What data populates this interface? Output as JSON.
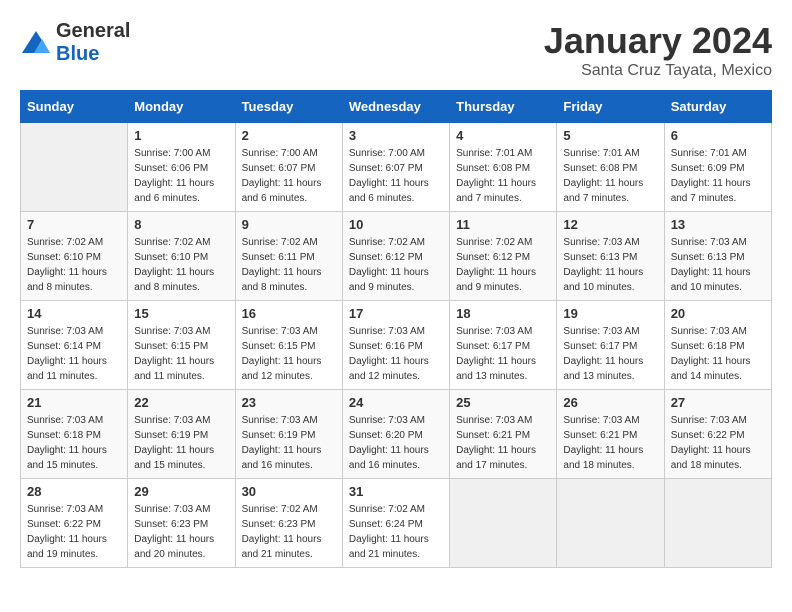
{
  "header": {
    "logo_general": "General",
    "logo_blue": "Blue",
    "title": "January 2024",
    "subtitle": "Santa Cruz Tayata, Mexico"
  },
  "calendar": {
    "weekdays": [
      "Sunday",
      "Monday",
      "Tuesday",
      "Wednesday",
      "Thursday",
      "Friday",
      "Saturday"
    ],
    "weeks": [
      [
        {
          "day": "",
          "sunrise": "",
          "sunset": "",
          "daylight": ""
        },
        {
          "day": "1",
          "sunrise": "Sunrise: 7:00 AM",
          "sunset": "Sunset: 6:06 PM",
          "daylight": "Daylight: 11 hours and 6 minutes."
        },
        {
          "day": "2",
          "sunrise": "Sunrise: 7:00 AM",
          "sunset": "Sunset: 6:07 PM",
          "daylight": "Daylight: 11 hours and 6 minutes."
        },
        {
          "day": "3",
          "sunrise": "Sunrise: 7:00 AM",
          "sunset": "Sunset: 6:07 PM",
          "daylight": "Daylight: 11 hours and 6 minutes."
        },
        {
          "day": "4",
          "sunrise": "Sunrise: 7:01 AM",
          "sunset": "Sunset: 6:08 PM",
          "daylight": "Daylight: 11 hours and 7 minutes."
        },
        {
          "day": "5",
          "sunrise": "Sunrise: 7:01 AM",
          "sunset": "Sunset: 6:08 PM",
          "daylight": "Daylight: 11 hours and 7 minutes."
        },
        {
          "day": "6",
          "sunrise": "Sunrise: 7:01 AM",
          "sunset": "Sunset: 6:09 PM",
          "daylight": "Daylight: 11 hours and 7 minutes."
        }
      ],
      [
        {
          "day": "7",
          "sunrise": "Sunrise: 7:02 AM",
          "sunset": "Sunset: 6:10 PM",
          "daylight": "Daylight: 11 hours and 8 minutes."
        },
        {
          "day": "8",
          "sunrise": "Sunrise: 7:02 AM",
          "sunset": "Sunset: 6:10 PM",
          "daylight": "Daylight: 11 hours and 8 minutes."
        },
        {
          "day": "9",
          "sunrise": "Sunrise: 7:02 AM",
          "sunset": "Sunset: 6:11 PM",
          "daylight": "Daylight: 11 hours and 8 minutes."
        },
        {
          "day": "10",
          "sunrise": "Sunrise: 7:02 AM",
          "sunset": "Sunset: 6:12 PM",
          "daylight": "Daylight: 11 hours and 9 minutes."
        },
        {
          "day": "11",
          "sunrise": "Sunrise: 7:02 AM",
          "sunset": "Sunset: 6:12 PM",
          "daylight": "Daylight: 11 hours and 9 minutes."
        },
        {
          "day": "12",
          "sunrise": "Sunrise: 7:03 AM",
          "sunset": "Sunset: 6:13 PM",
          "daylight": "Daylight: 11 hours and 10 minutes."
        },
        {
          "day": "13",
          "sunrise": "Sunrise: 7:03 AM",
          "sunset": "Sunset: 6:13 PM",
          "daylight": "Daylight: 11 hours and 10 minutes."
        }
      ],
      [
        {
          "day": "14",
          "sunrise": "Sunrise: 7:03 AM",
          "sunset": "Sunset: 6:14 PM",
          "daylight": "Daylight: 11 hours and 11 minutes."
        },
        {
          "day": "15",
          "sunrise": "Sunrise: 7:03 AM",
          "sunset": "Sunset: 6:15 PM",
          "daylight": "Daylight: 11 hours and 11 minutes."
        },
        {
          "day": "16",
          "sunrise": "Sunrise: 7:03 AM",
          "sunset": "Sunset: 6:15 PM",
          "daylight": "Daylight: 11 hours and 12 minutes."
        },
        {
          "day": "17",
          "sunrise": "Sunrise: 7:03 AM",
          "sunset": "Sunset: 6:16 PM",
          "daylight": "Daylight: 11 hours and 12 minutes."
        },
        {
          "day": "18",
          "sunrise": "Sunrise: 7:03 AM",
          "sunset": "Sunset: 6:17 PM",
          "daylight": "Daylight: 11 hours and 13 minutes."
        },
        {
          "day": "19",
          "sunrise": "Sunrise: 7:03 AM",
          "sunset": "Sunset: 6:17 PM",
          "daylight": "Daylight: 11 hours and 13 minutes."
        },
        {
          "day": "20",
          "sunrise": "Sunrise: 7:03 AM",
          "sunset": "Sunset: 6:18 PM",
          "daylight": "Daylight: 11 hours and 14 minutes."
        }
      ],
      [
        {
          "day": "21",
          "sunrise": "Sunrise: 7:03 AM",
          "sunset": "Sunset: 6:18 PM",
          "daylight": "Daylight: 11 hours and 15 minutes."
        },
        {
          "day": "22",
          "sunrise": "Sunrise: 7:03 AM",
          "sunset": "Sunset: 6:19 PM",
          "daylight": "Daylight: 11 hours and 15 minutes."
        },
        {
          "day": "23",
          "sunrise": "Sunrise: 7:03 AM",
          "sunset": "Sunset: 6:19 PM",
          "daylight": "Daylight: 11 hours and 16 minutes."
        },
        {
          "day": "24",
          "sunrise": "Sunrise: 7:03 AM",
          "sunset": "Sunset: 6:20 PM",
          "daylight": "Daylight: 11 hours and 16 minutes."
        },
        {
          "day": "25",
          "sunrise": "Sunrise: 7:03 AM",
          "sunset": "Sunset: 6:21 PM",
          "daylight": "Daylight: 11 hours and 17 minutes."
        },
        {
          "day": "26",
          "sunrise": "Sunrise: 7:03 AM",
          "sunset": "Sunset: 6:21 PM",
          "daylight": "Daylight: 11 hours and 18 minutes."
        },
        {
          "day": "27",
          "sunrise": "Sunrise: 7:03 AM",
          "sunset": "Sunset: 6:22 PM",
          "daylight": "Daylight: 11 hours and 18 minutes."
        }
      ],
      [
        {
          "day": "28",
          "sunrise": "Sunrise: 7:03 AM",
          "sunset": "Sunset: 6:22 PM",
          "daylight": "Daylight: 11 hours and 19 minutes."
        },
        {
          "day": "29",
          "sunrise": "Sunrise: 7:03 AM",
          "sunset": "Sunset: 6:23 PM",
          "daylight": "Daylight: 11 hours and 20 minutes."
        },
        {
          "day": "30",
          "sunrise": "Sunrise: 7:02 AM",
          "sunset": "Sunset: 6:23 PM",
          "daylight": "Daylight: 11 hours and 21 minutes."
        },
        {
          "day": "31",
          "sunrise": "Sunrise: 7:02 AM",
          "sunset": "Sunset: 6:24 PM",
          "daylight": "Daylight: 11 hours and 21 minutes."
        },
        {
          "day": "",
          "sunrise": "",
          "sunset": "",
          "daylight": ""
        },
        {
          "day": "",
          "sunrise": "",
          "sunset": "",
          "daylight": ""
        },
        {
          "day": "",
          "sunrise": "",
          "sunset": "",
          "daylight": ""
        }
      ]
    ]
  }
}
